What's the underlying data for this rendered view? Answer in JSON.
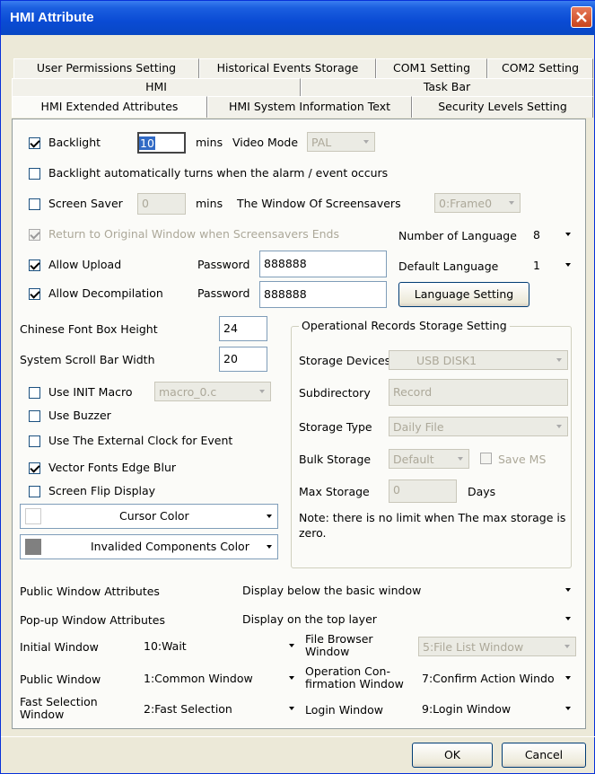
{
  "window": {
    "title": "HMI Attribute"
  },
  "tabs": {
    "row1": [
      "User Permissions Setting",
      "Historical Events Storage",
      "COM1 Setting",
      "COM2 Setting"
    ],
    "row2": [
      "HMI",
      "Task Bar"
    ],
    "row3": [
      "HMI Extended Attributes",
      "HMI System Information Text",
      "Security Levels Setting"
    ]
  },
  "top": {
    "backlight_label": "Backlight",
    "backlight_value": "10",
    "mins1": "mins",
    "video_mode_label": "Video Mode",
    "video_mode_value": "PAL",
    "backlight_alarm_label": "Backlight automatically turns when the alarm / event occurs",
    "screen_saver_label": "Screen Saver",
    "screen_saver_value": "0",
    "mins2": "mins",
    "screensaver_window_label": "The Window Of Screensavers",
    "screensaver_window_value": "0:Frame0",
    "return_label": "Return to Original Window when Screensavers Ends",
    "num_lang_label": "Number of Language",
    "num_lang_value": "8",
    "allow_upload_label": "Allow Upload",
    "password_label1": "Password",
    "password_value1": "888888",
    "default_lang_label": "Default Language",
    "default_lang_value": "1",
    "allow_decomp_label": "Allow Decompilation",
    "password_label2": "Password",
    "password_value2": "888888",
    "language_setting_btn": "Language Setting"
  },
  "left": {
    "chinese_font_label": "Chinese Font Box Height",
    "chinese_font_value": "24",
    "scroll_bar_label": "System Scroll Bar Width",
    "scroll_bar_value": "20",
    "use_init_macro_label": "Use INIT Macro",
    "init_macro_value": "macro_0.c",
    "use_buzzer_label": "Use Buzzer",
    "ext_clock_label": "Use The External Clock for Event",
    "vector_fonts_label": "Vector Fonts Edge Blur",
    "screen_flip_label": "Screen Flip Display",
    "cursor_color_label": "Cursor Color",
    "cursor_color": "#ffffff",
    "invalid_color_label": "Invalided Components Color",
    "invalid_color": "#808080"
  },
  "records": {
    "legend": "Operational Records Storage Setting",
    "storage_devices_label": "Storage Devices",
    "storage_devices_value": "USB DISK1",
    "subdirectory_label": "Subdirectory",
    "subdirectory_value": "Record",
    "storage_type_label": "Storage Type",
    "storage_type_value": "Daily File",
    "bulk_storage_label": "Bulk Storage",
    "bulk_storage_value": "Default",
    "save_ms_label": "Save MS",
    "max_storage_label": "Max Storage",
    "max_storage_value": "0",
    "days_label": "Days",
    "note": "Note: there is no limit when The max storage is zero."
  },
  "bottom": {
    "public_attr_label": "Public Window Attributes",
    "public_attr_value": "Display below the basic window",
    "popup_attr_label": "Pop-up Window Attributes",
    "popup_attr_value": "Display on the top layer",
    "initial_window_label": "Initial Window",
    "initial_window_value": "10:Wait",
    "file_browser_label": "File Browser Window",
    "file_browser_value": "5:File List Window",
    "public_window_label": "Public Window",
    "public_window_value": "1:Common Window",
    "op_confirm_label": "Operation Con- firmation Window",
    "op_confirm_value": "7:Confirm Action Windo",
    "fast_sel_label": "Fast Selection Window",
    "fast_sel_value": "2:Fast Selection",
    "login_label": "Login Window",
    "login_value": "9:Login Window"
  },
  "buttons": {
    "ok": "OK",
    "cancel": "Cancel"
  }
}
